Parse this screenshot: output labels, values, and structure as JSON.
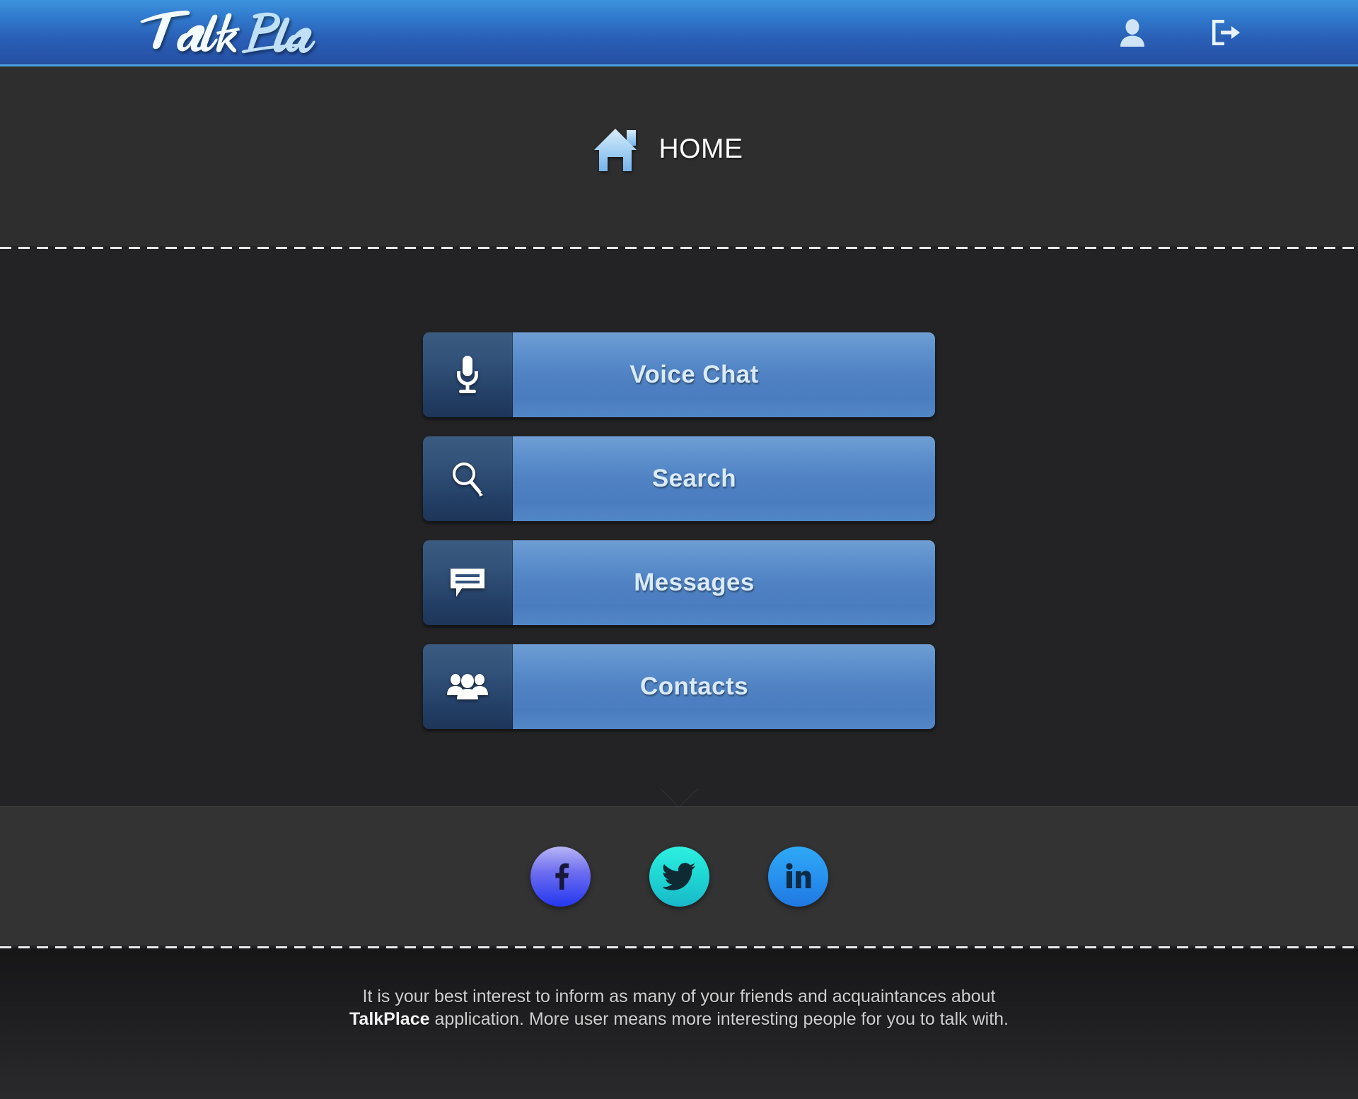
{
  "header": {
    "brand_name": "Talk Place",
    "actions": [
      {
        "name": "profile-icon",
        "label": "Profile"
      },
      {
        "name": "logout-icon",
        "label": "Log out"
      }
    ]
  },
  "nav": {
    "icon": "home-icon",
    "title": "HOME"
  },
  "main": {
    "buttons": [
      {
        "label": "Voice Chat",
        "icon": "microphone-icon"
      },
      {
        "label": "Search",
        "icon": "search-icon"
      },
      {
        "label": "Messages",
        "icon": "message-bubble-icon"
      },
      {
        "label": "Contacts",
        "icon": "people-group-icon"
      }
    ]
  },
  "social": {
    "links": [
      {
        "label": "Facebook",
        "icon": "facebook-icon",
        "color": "#2437ef"
      },
      {
        "label": "Twitter",
        "icon": "twitter-icon",
        "color": "#1fd9d4"
      },
      {
        "label": "LinkedIn",
        "icon": "linkedin-icon",
        "color": "#2792ef"
      }
    ]
  },
  "footer": {
    "line1": "It is your best interest to inform as many of your friends and acquaintances about",
    "brand_bold": "TalkPlace",
    "line2_rest": " application. More user means more interesting people for you to talk with."
  },
  "theme": {
    "header_top": "#3e93dd",
    "header_bottom": "#254fa3",
    "header_rule": "#4ea0e0",
    "nav_bg": "#2e2e2f",
    "main_bg": "#232325",
    "social_bg": "#333334",
    "button_blue": "#4e80c2",
    "button_icon_panel": "#254168",
    "button_text": "#d9eaf8"
  }
}
